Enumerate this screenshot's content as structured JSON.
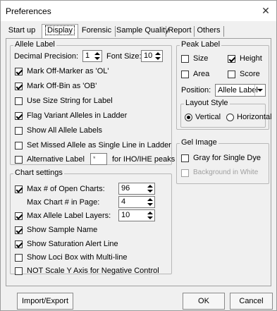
{
  "window": {
    "title": "Preferences",
    "close_glyph": "✕"
  },
  "tabs": [
    {
      "label": "Start up"
    },
    {
      "label": "Display",
      "active": true
    },
    {
      "label": "Forensic"
    },
    {
      "label": "Sample Quality"
    },
    {
      "label": "Report"
    },
    {
      "label": "Others"
    }
  ],
  "allele_label": {
    "title": "Allele Label",
    "decimal_precision_label": "Decimal Precision:",
    "decimal_precision_value": "1",
    "font_size_label": "Font Size:",
    "font_size_value": "10",
    "options": [
      {
        "label": "Mark Off-Marker as 'OL'",
        "checked": true
      },
      {
        "label": "Mark Off-Bin as 'OB'",
        "checked": true
      },
      {
        "label": "Use Size String for Label",
        "checked": false
      },
      {
        "label": "Flag Variant Alleles in Ladder",
        "checked": true
      },
      {
        "label": "Show All Allele Labels",
        "checked": false
      },
      {
        "label": "Set Missed Allele as Single Line in Ladder",
        "checked": false
      }
    ],
    "alternative_label": "Alternative Label",
    "alternative_value": "*",
    "alternative_suffix": "for IHO/IHE peaks"
  },
  "chart_settings": {
    "title": "Chart settings",
    "max_open_charts_label": "Max # of Open Charts:",
    "max_open_charts_value": "96",
    "max_chart_in_page_label": "Max Chart # in Page:",
    "max_chart_in_page_value": "4",
    "max_allele_layers_label": "Max Allele Label Layers:",
    "max_allele_layers_value": "10",
    "options": [
      {
        "label": "Show Sample Name",
        "checked": true
      },
      {
        "label": "Show Saturation Alert Line",
        "checked": true
      },
      {
        "label": "Show Loci Box with Multi-line",
        "checked": false
      },
      {
        "label": "NOT Scale Y Axis for Negative Control",
        "checked": false
      }
    ]
  },
  "peak_label": {
    "title": "Peak Label",
    "size_label": "Size",
    "height_label": "Height",
    "area_label": "Area",
    "score_label": "Score",
    "position_label": "Position:",
    "position_value": "Allele Label",
    "layout_style_title": "Layout Style",
    "vertical_label": "Vertical",
    "horizontal_label": "Horizontal"
  },
  "gel_image": {
    "title": "Gel Image",
    "gray_label": "Gray for Single Dye",
    "background_label": "Background in White"
  },
  "buttons": {
    "import_export": "Import/Export",
    "ok": "OK",
    "cancel": "Cancel"
  }
}
